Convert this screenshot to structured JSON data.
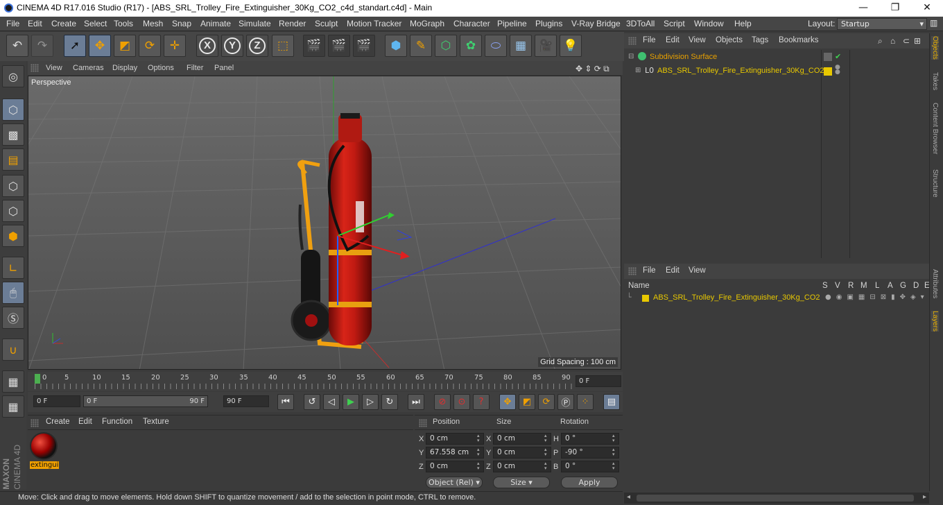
{
  "window": {
    "title": "CINEMA 4D R17.016 Studio (R17) - [ABS_SRL_Trolley_Fire_Extinguisher_30Kg_CO2_c4d_standart.c4d] - Main",
    "minimize": "—",
    "maximize": "❐",
    "close": "✕"
  },
  "menu": [
    "File",
    "Edit",
    "Create",
    "Select",
    "Tools",
    "Mesh",
    "Snap",
    "Animate",
    "Simulate",
    "Render",
    "Sculpt",
    "Motion Tracker",
    "MoGraph",
    "Character",
    "Pipeline",
    "Plugins",
    "V-Ray Bridge",
    "3DToAll",
    "Script",
    "Window",
    "Help"
  ],
  "layout": {
    "label": "Layout:",
    "value": "Startup"
  },
  "viewport": {
    "menu": [
      "View",
      "Cameras",
      "Display",
      "Options",
      "Filter",
      "Panel"
    ],
    "label": "Perspective",
    "grid_spacing": "Grid Spacing : 100 cm"
  },
  "timeline": {
    "ticks": [
      "0",
      "5",
      "10",
      "15",
      "20",
      "25",
      "30",
      "35",
      "40",
      "45",
      "50",
      "55",
      "60",
      "65",
      "70",
      "75",
      "80",
      "85",
      "90"
    ],
    "current_frame": "0 F"
  },
  "transport": {
    "start": "0 F",
    "range_start": "0 F",
    "range_end": "90 F",
    "end": "90 F"
  },
  "material_panel": {
    "menu": [
      "Create",
      "Edit",
      "Function",
      "Texture"
    ],
    "materials": [
      {
        "name": "extingui"
      }
    ]
  },
  "coordinates": {
    "headers": {
      "position": "Position",
      "size": "Size",
      "rotation": "Rotation"
    },
    "rows": [
      {
        "pos_axis": "X",
        "pos": "0 cm",
        "size_axis": "X",
        "size": "0 cm",
        "rot_axis": "H",
        "rot": "0 °"
      },
      {
        "pos_axis": "Y",
        "pos": "67.558 cm",
        "size_axis": "Y",
        "size": "0 cm",
        "rot_axis": "P",
        "rot": "-90 °"
      },
      {
        "pos_axis": "Z",
        "pos": "0 cm",
        "size_axis": "Z",
        "size": "0 cm",
        "rot_axis": "B",
        "rot": "0 °"
      }
    ],
    "mode": "Object (Rel)",
    "size_mode": "Size",
    "apply": "Apply"
  },
  "status": "Move: Click and drag to move elements. Hold down SHIFT to quantize movement / add to the selection in point mode, CTRL to remove.",
  "object_manager": {
    "menu": [
      "File",
      "Edit",
      "View",
      "Objects",
      "Tags",
      "Bookmarks"
    ],
    "objects": [
      {
        "name": "Subdivision Surface",
        "color": "#e8a000"
      },
      {
        "name": "ABS_SRL_Trolley_Fire_Extinguisher_30Kg_CO2",
        "color": "#e8c800"
      }
    ]
  },
  "layer_manager": {
    "menu": [
      "File",
      "Edit",
      "View"
    ],
    "columns": {
      "name": "Name",
      "flags": [
        "S",
        "V",
        "R",
        "M",
        "L",
        "A",
        "G",
        "D",
        "E"
      ]
    },
    "layers": [
      {
        "name": "ABS_SRL_Trolley_Fire_Extinguisher_30Kg_CO2",
        "color": "#e8c800"
      }
    ]
  },
  "side_tabs": [
    "Objects",
    "Takes",
    "Content Browser",
    "Structure",
    "Attributes",
    "Layers"
  ],
  "brand": {
    "maxon": "MAXON",
    "product": "CINEMA 4D"
  }
}
